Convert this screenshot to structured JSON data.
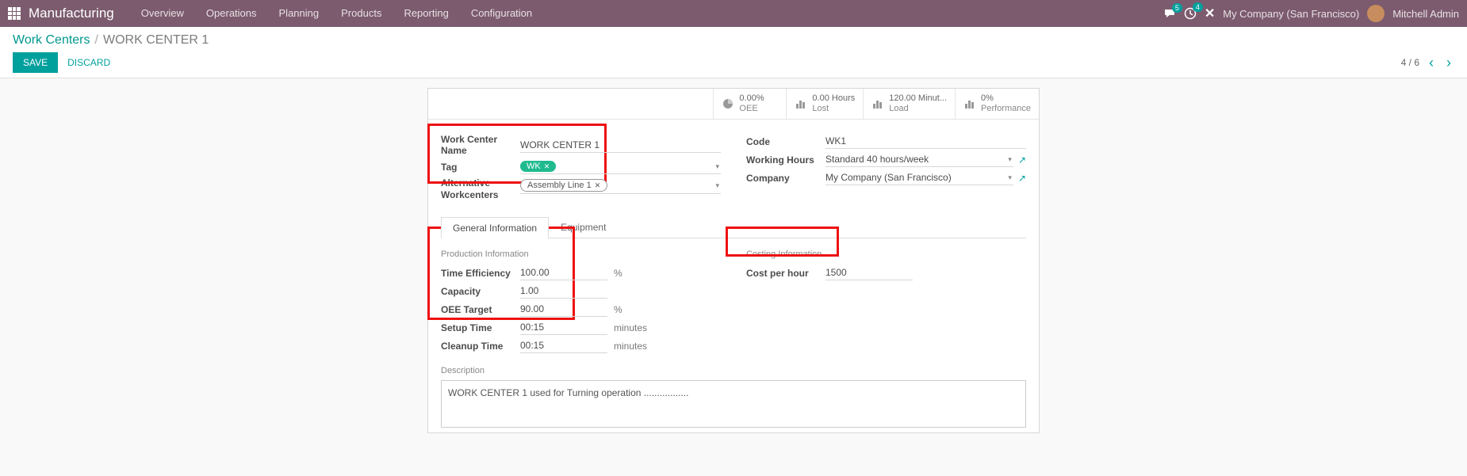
{
  "navbar": {
    "brand": "Manufacturing",
    "menu": [
      "Overview",
      "Operations",
      "Planning",
      "Products",
      "Reporting",
      "Configuration"
    ],
    "chat_badge": "5",
    "activity_badge": "4",
    "company": "My Company (San Francisco)",
    "user": "Mitchell Admin"
  },
  "breadcrumb": {
    "parent": "Work Centers",
    "current": "WORK CENTER 1"
  },
  "buttons": {
    "save": "SAVE",
    "discard": "DISCARD"
  },
  "pager": {
    "text": "4 / 6"
  },
  "stats": {
    "oee": {
      "value": "0.00%",
      "label": "OEE"
    },
    "lost": {
      "value": "0.00 Hours",
      "label": "Lost"
    },
    "load": {
      "value": "120.00 Minut...",
      "label": "Load"
    },
    "perf": {
      "value": "0%",
      "label": "Performance"
    }
  },
  "fields": {
    "name_label": "Work Center Name",
    "name_value": "WORK CENTER 1",
    "tag_label": "Tag",
    "tag_value": "WK",
    "alt_label": "Alternative Workcenters",
    "alt_value": "Assembly Line 1",
    "code_label": "Code",
    "code_value": "WK1",
    "hours_label": "Working Hours",
    "hours_value": "Standard 40 hours/week",
    "company_label": "Company",
    "company_value": "My Company (San Francisco)"
  },
  "tabs": {
    "general": "General Information",
    "equipment": "Equipment"
  },
  "sections": {
    "prod_title": "Production Information",
    "cost_title": "Costing Information",
    "time_eff_label": "Time Efficiency",
    "time_eff_value": "100.00",
    "capacity_label": "Capacity",
    "capacity_value": "1.00",
    "oee_target_label": "OEE Target",
    "oee_target_value": "90.00",
    "setup_label": "Setup Time",
    "setup_value": "00:15",
    "cleanup_label": "Cleanup Time",
    "cleanup_value": "00:15",
    "minutes": "minutes",
    "percent": "%",
    "cph_label": "Cost per hour",
    "cph_value": "1500"
  },
  "description": {
    "label": "Description",
    "text": "WORK CENTER 1 used for Turning operation  ................."
  }
}
